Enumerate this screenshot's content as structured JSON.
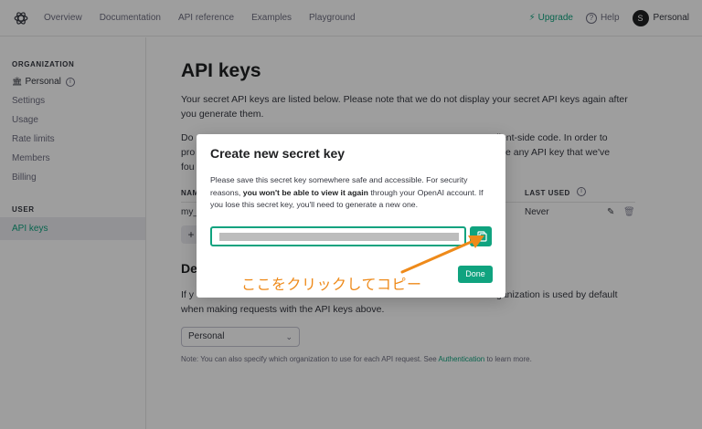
{
  "topnav": {
    "links": [
      "Overview",
      "Documentation",
      "API reference",
      "Examples",
      "Playground"
    ],
    "upgrade": "Upgrade",
    "help": "Help",
    "user_initial": "S",
    "user_name": "Personal"
  },
  "sidebar": {
    "org_heading": "ORGANIZATION",
    "org_name": "Personal",
    "org_items": [
      "Settings",
      "Usage",
      "Rate limits",
      "Members",
      "Billing"
    ],
    "user_heading": "USER",
    "user_items": [
      "API keys"
    ]
  },
  "main": {
    "title": "API keys",
    "intro": "Your secret API keys are listed below. Please note that we do not display your secret API keys again after you generate them.",
    "para2_left_line1": "Do",
    "para2_left_line2": "pro",
    "para2_left_line3": "fou",
    "para2_right_line1": "client-side code. In order to",
    "para2_right_line2": "e any API key that we've",
    "col_name_partial": "NAM",
    "col_last_used": "LAST USED",
    "row_name_partial": "my_",
    "row_last_used": "Never",
    "add_label": "+",
    "section_partial": "De",
    "default_left_partial": "If y",
    "default_right_partial": "ganization is used by default",
    "default_line2": "when making requests with the API keys above.",
    "select_value": "Personal",
    "note_prefix": "Note: You can also specify which organization to use for each API request. See ",
    "note_link": "Authentication",
    "note_suffix": " to learn more."
  },
  "modal": {
    "title": "Create new secret key",
    "text_before": "Please save this secret key somewhere safe and accessible. For security reasons, ",
    "text_bold": "you won't be able to view it again",
    "text_after": " through your OpenAI account. If you lose this secret key, you'll need to generate a new one.",
    "done": "Done"
  },
  "annotation": {
    "text": "ここをクリックしてコピー",
    "color": "#ee8a1a"
  },
  "colors": {
    "accent": "#10a37f"
  }
}
